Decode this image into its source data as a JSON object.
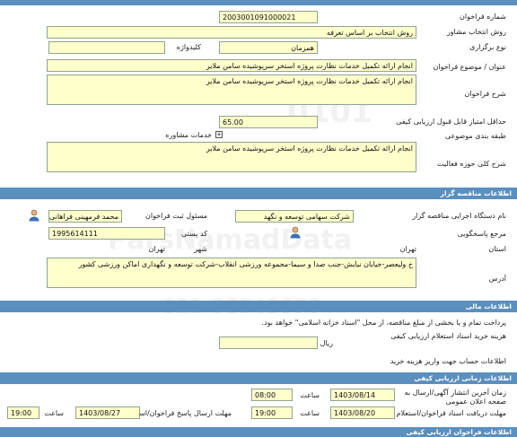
{
  "general": {
    "number_label": "شماره فراخوان",
    "number_value": "2003001091000021",
    "method_label": "روش انتخاب مشاور",
    "method_value": "روش انتخاب بر اساس تعرفه",
    "type_label": "نوع برگزاری",
    "type_value": "همزمان",
    "keyword_label": "کلیدواژه",
    "subject_label": "عنوان / موضوع فراخوان",
    "subject_value": "انجام ارائه تکمیل خدمات نظارت پروژه استخر سرپوشیده سامن ملایر",
    "description_label": "شرح فراخوان",
    "description_value": "انجام ارائه تکمیل خدمات نظارت پروژه استخر سرپوشیده سامن ملایر",
    "min_score_label": "حداقل امتیاز قابل قبول ارزیابی کیفی",
    "min_score_value": "65.00",
    "category_label": "طبقه بندی موضوعی",
    "category_value": "خدمات مشاوره",
    "scope_label": "شرح کلی حوزه فعالیت",
    "scope_value": "انجام ارائه تکمیل خدمات نظارت پروژه استخر سرپوشیده سامن ملایر"
  },
  "organizer": {
    "section_title": "اطلاعات مناقصه گزار",
    "org_label": "نام دستگاه اجرایی مناقصه گزار",
    "org_value": "شرکت سهامی توسعه و نگهد",
    "responsible_label": "مسئول ثبت فراخوان",
    "responsible_value": "محمد فرمهینی فراهانی",
    "reference_label": "مرجع پاسخگویی",
    "postal_label": "کد پستی",
    "postal_value": "1995614111",
    "province_label": "استان",
    "province_value": "تهران",
    "city_label": "شهر",
    "city_value": "تهران",
    "address_label": "آدرس",
    "address_value": "خ ولیعصر-خیابان نیایش-جنب صدا و سیما-مجموعه ورزشی انقلاب-شرکت توسعه و نگهداری اماکن ورزشی کشور"
  },
  "financial": {
    "section_title": "اطلاعات مالی",
    "note": "پرداخت تمام و یا بخشی از مبلغ مناقصه، از محل \"اسناد خزانه اسلامی\" خواهد بود.",
    "fee_label": "هزینه خرید اسناد استعلام ارزیابی کیفی",
    "currency": "ریال",
    "account_label": "اطلاعات حساب جهت واریز هزینه خرید"
  },
  "timing": {
    "section_title": "اطلاعات زمانی ارزیابی کیفی",
    "publish_label": "زمان آخرین انتشار آگهی/ارسال به صفحه اعلان عمومی",
    "publish_date": "1403/08/14",
    "publish_time_label": "ساعت",
    "publish_time": "08:00",
    "receive_label": "مهلت دریافت اسناد فراخوان/استعلام",
    "receive_date": "1403/08/20",
    "receive_time_label": "ساعت",
    "receive_time": "19:00",
    "send_label": "مهلت ارسال پاسخ فراخوان/استعلام",
    "send_date": "1403/08/27",
    "send_time_label": "ساعت",
    "send_time": "19:00"
  },
  "footer": {
    "section_title": "اطلاعات فراخوان ارزیابی کیفی"
  },
  "colors": {
    "section_bar": "#5a8fbe",
    "field_bg": "#ffffcc",
    "field_border": "#8fa38f"
  }
}
